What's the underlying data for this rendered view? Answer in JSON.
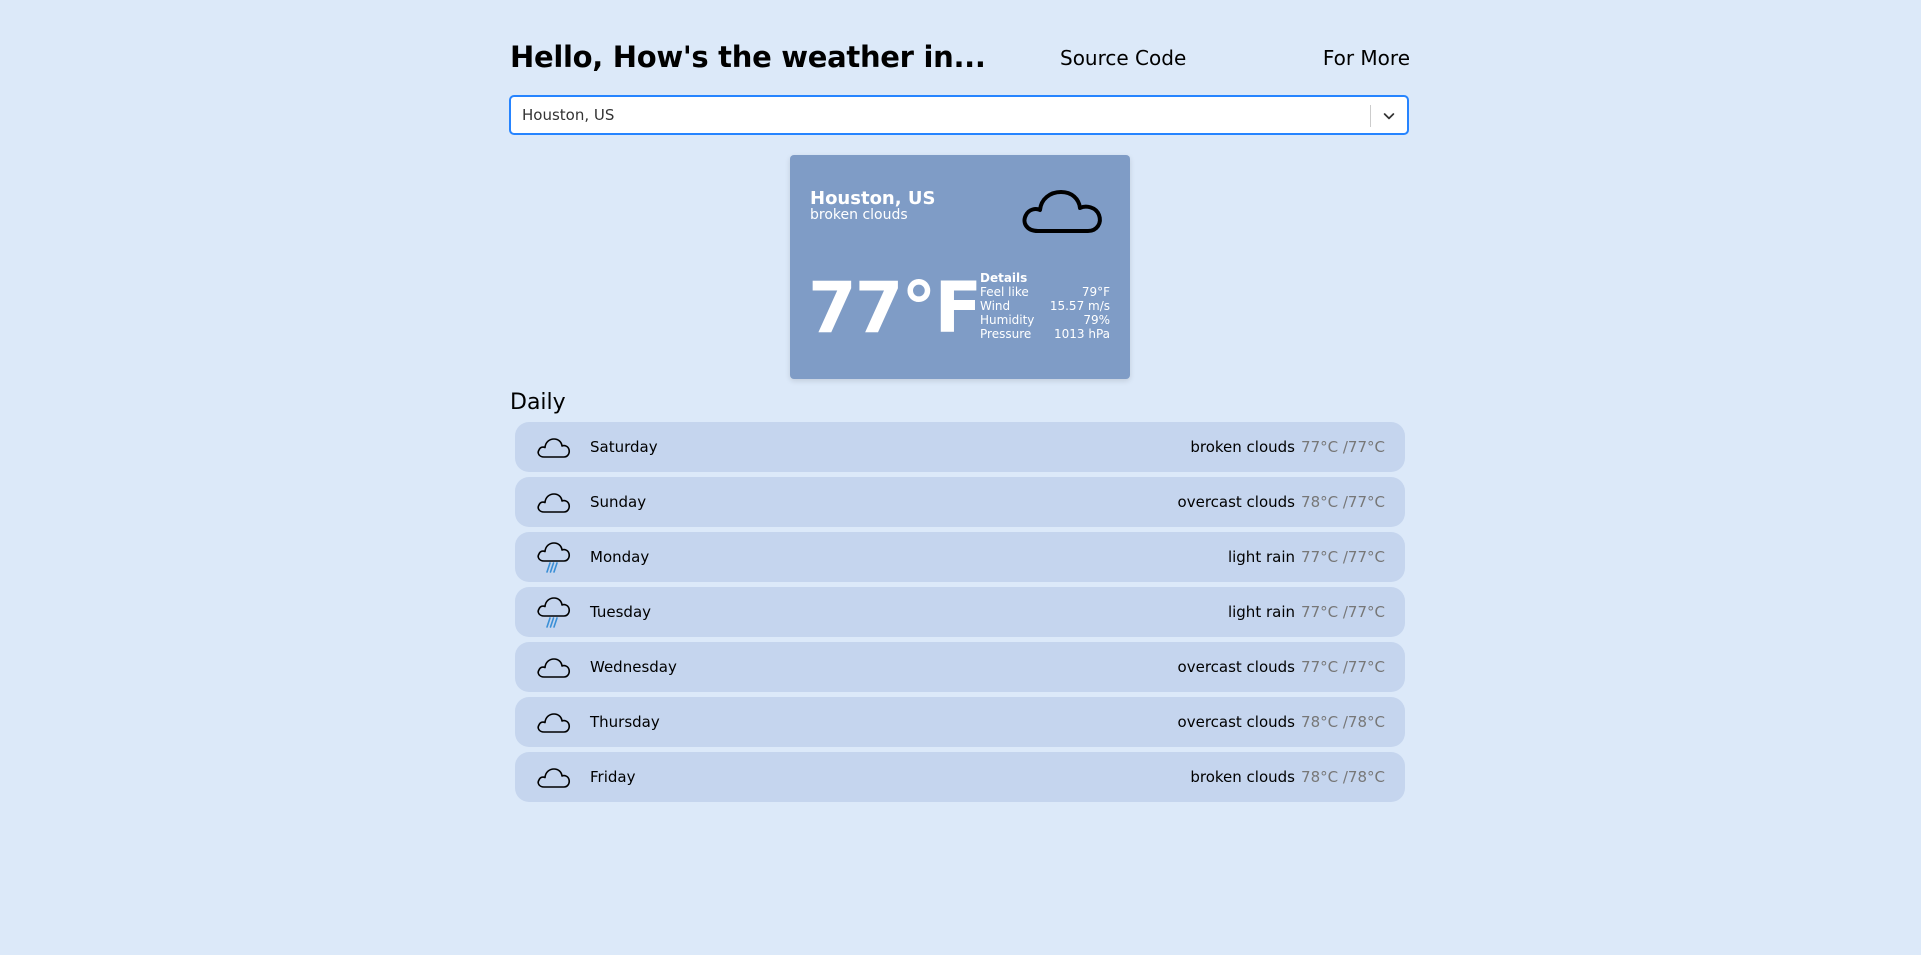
{
  "header": {
    "title": "Hello, How's the weather in...",
    "source_code": "Source Code",
    "for_more": "For More"
  },
  "search": {
    "value": "Houston, US"
  },
  "current": {
    "city": "Houston, US",
    "description": "broken clouds",
    "icon": "cloud-icon",
    "temperature": "77°F",
    "details_title": "Details",
    "details": [
      {
        "label": "Feel like",
        "value": "79°F"
      },
      {
        "label": "Wind",
        "value": "15.57 m/s"
      },
      {
        "label": "Humidity",
        "value": "79%"
      },
      {
        "label": "Pressure",
        "value": "1013 hPa"
      }
    ]
  },
  "daily": {
    "title": "Daily",
    "days": [
      {
        "day": "Saturday",
        "description": "broken clouds",
        "temps": "77°C /77°C",
        "icon": "cloud-icon"
      },
      {
        "day": "Sunday",
        "description": "overcast clouds",
        "temps": "78°C /77°C",
        "icon": "cloud-icon"
      },
      {
        "day": "Monday",
        "description": "light rain",
        "temps": "77°C /77°C",
        "icon": "rain-cloud-icon"
      },
      {
        "day": "Tuesday",
        "description": "light rain",
        "temps": "77°C /77°C",
        "icon": "rain-cloud-icon"
      },
      {
        "day": "Wednesday",
        "description": "overcast clouds",
        "temps": "77°C /77°C",
        "icon": "cloud-icon"
      },
      {
        "day": "Thursday",
        "description": "overcast clouds",
        "temps": "78°C /78°C",
        "icon": "cloud-icon"
      },
      {
        "day": "Friday",
        "description": "broken clouds",
        "temps": "78°C /78°C",
        "icon": "cloud-icon"
      }
    ]
  },
  "colors": {
    "background": "#dce9f9",
    "card": "#7f9cc6",
    "row": "#c5d5ee",
    "rain": "#3a8fd6",
    "focus": "#2684ff"
  }
}
